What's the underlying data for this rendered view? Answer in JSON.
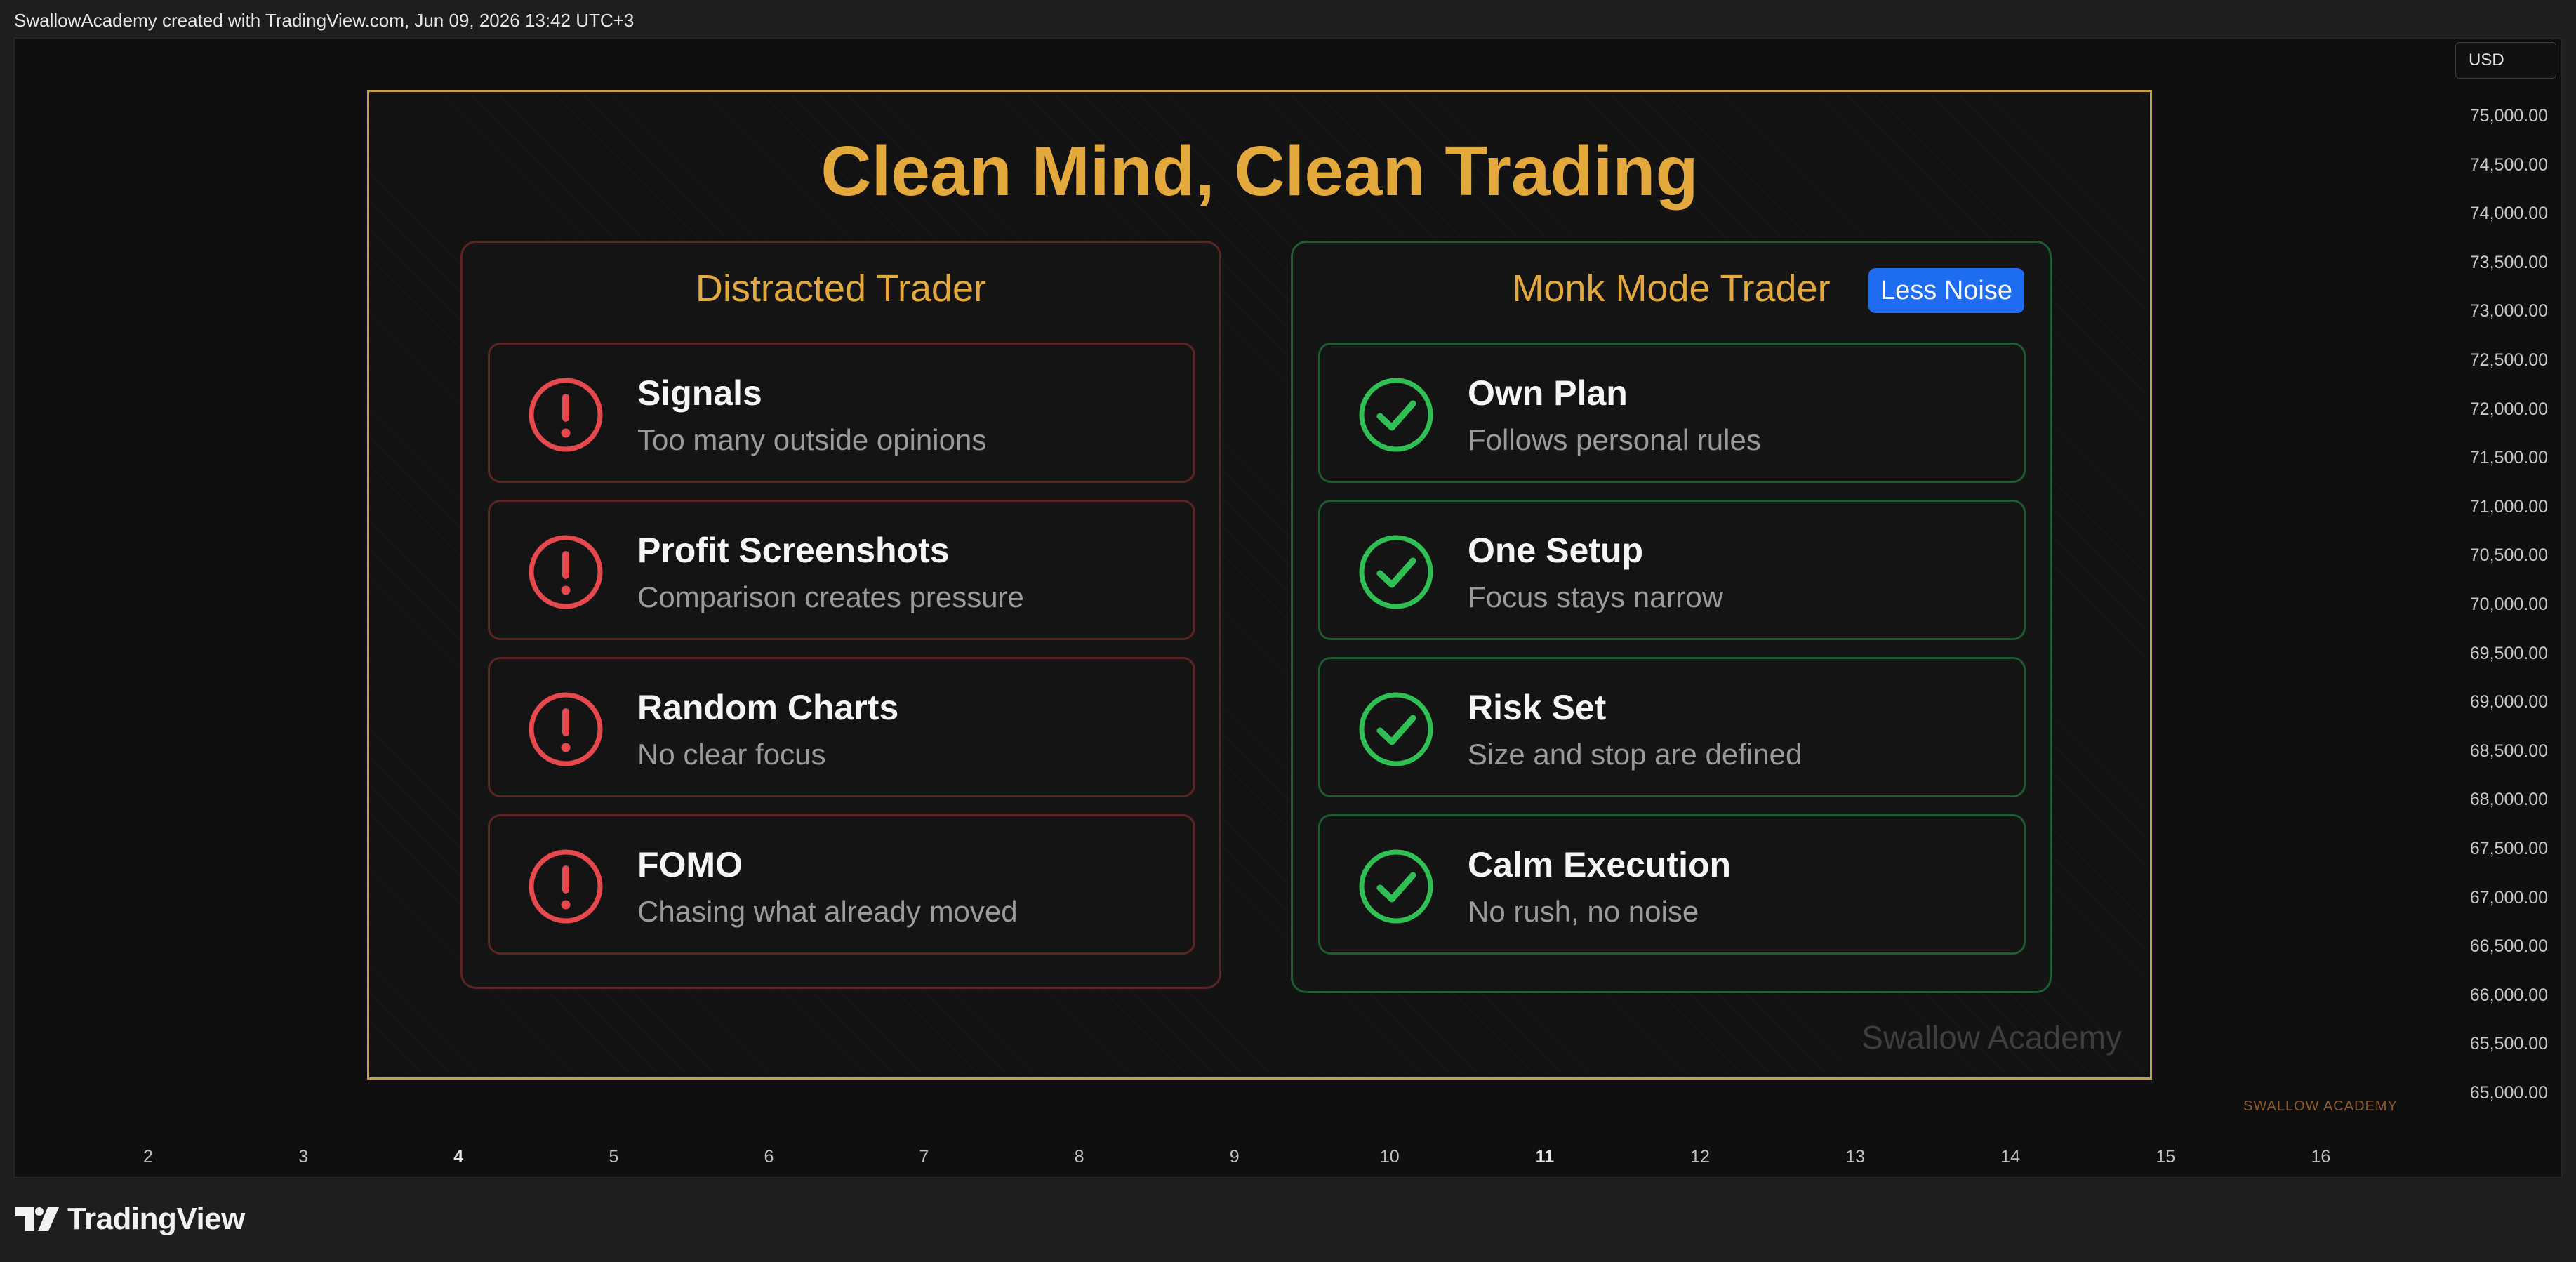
{
  "header": {
    "caption": "SwallowAcademy created with TradingView.com, Jun 09, 2026 13:42 UTC+3"
  },
  "price_axis": {
    "currency": "USD",
    "labels": [
      "75,000.00",
      "74,500.00",
      "74,000.00",
      "73,500.00",
      "73,000.00",
      "72,500.00",
      "72,000.00",
      "71,500.00",
      "71,000.00",
      "70,500.00",
      "70,000.00",
      "69,500.00",
      "69,000.00",
      "68,500.00",
      "68,000.00",
      "67,500.00",
      "67,000.00",
      "66,500.00",
      "66,000.00",
      "65,500.00",
      "65,000.00"
    ]
  },
  "time_axis": {
    "labels": [
      "2",
      "3",
      "4",
      "5",
      "6",
      "7",
      "8",
      "9",
      "10",
      "11",
      "12",
      "13",
      "14",
      "15",
      "16"
    ],
    "bold": [
      "4",
      "11"
    ]
  },
  "chart_mark": "SWALLOW ACADEMY",
  "footer": {
    "brand": "TradingView"
  },
  "infographic": {
    "title": "Clean Mind, Clean Trading",
    "watermark": "Swallow Academy",
    "left_panel": {
      "title": "Distracted Trader",
      "icon": "exclamation-circle-icon",
      "color": "#e5484d",
      "items": [
        {
          "title": "Signals",
          "subtitle": "Too many outside opinions"
        },
        {
          "title": "Profit Screenshots",
          "subtitle": "Comparison creates pressure"
        },
        {
          "title": "Random Charts",
          "subtitle": "No clear focus"
        },
        {
          "title": "FOMO",
          "subtitle": "Chasing what already moved"
        }
      ]
    },
    "right_panel": {
      "title": "Monk Mode Trader",
      "badge": "Less Noise",
      "icon": "check-circle-icon",
      "color": "#2fbf55",
      "items": [
        {
          "title": "Own Plan",
          "subtitle": "Follows personal rules"
        },
        {
          "title": "One Setup",
          "subtitle": "Focus stays narrow"
        },
        {
          "title": "Risk Set",
          "subtitle": "Size and stop are defined"
        },
        {
          "title": "Calm Execution",
          "subtitle": "No rush, no noise"
        }
      ]
    }
  },
  "colors": {
    "accent_gold": "#e3a93d",
    "frame_gold": "#c9a04a",
    "badge_blue": "#1e6df0"
  }
}
